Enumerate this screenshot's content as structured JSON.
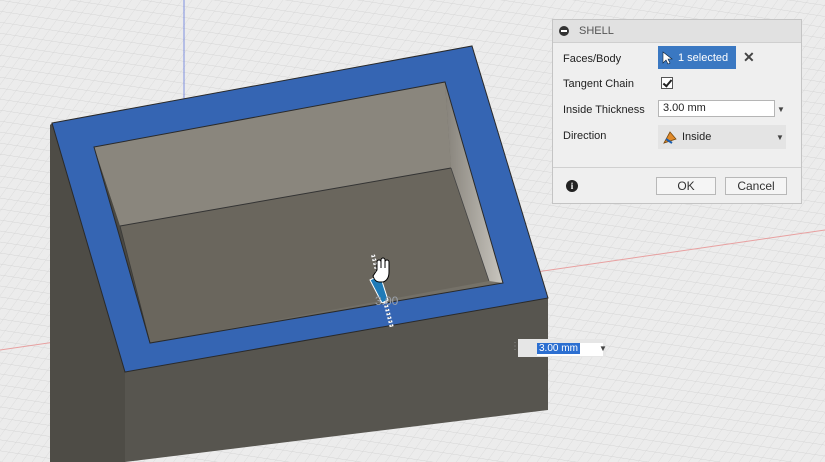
{
  "dialog": {
    "title": "SHELL",
    "faces_body": {
      "label": "Faces/Body",
      "value": "1 selected"
    },
    "tangent_chain": {
      "label": "Tangent Chain",
      "checked": true
    },
    "inside_thickness": {
      "label": "Inside Thickness",
      "value": "3.00 mm"
    },
    "direction": {
      "label": "Direction",
      "value": "Inside"
    },
    "ok_label": "OK",
    "cancel_label": "Cancel"
  },
  "viewport": {
    "dimension_input_value": "3.00 mm",
    "drag_label": "3.00"
  },
  "colors": {
    "selected_face": "#3565b3",
    "box_body": "#5a5852",
    "selection_button": "#3a78c2"
  },
  "icons": [
    "collapse-icon",
    "cursor-select-icon",
    "clear-selection-icon",
    "checkbox-checked-icon",
    "dropdown-arrow-icon",
    "direction-icon",
    "info-icon",
    "hand-cursor-icon",
    "drag-arrow-icon"
  ]
}
